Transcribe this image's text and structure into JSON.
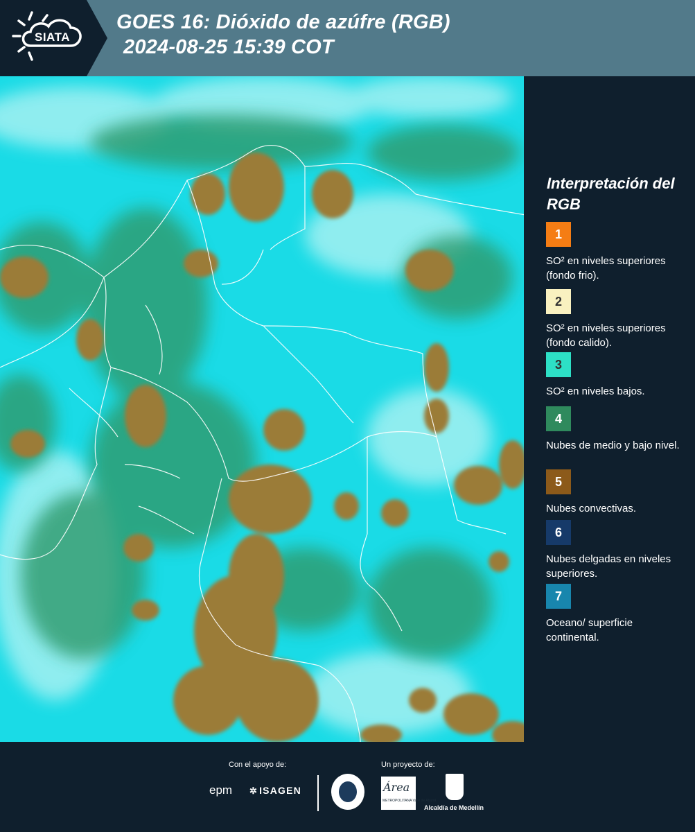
{
  "header": {
    "logo_text": "SIATA",
    "title_line1": "GOES 16: Dióxido de azúfre (RGB)",
    "title_line2": "2024-08-25 15:39 COT",
    "background_color": "#527a8a",
    "logo_bg_color": "#0f1f2d"
  },
  "map": {
    "description_icon": "satellite-rgb-map",
    "ocean_color": "#19dbe8",
    "cloud_color": "#9a7a3a",
    "low_cloud_color": "#2e9a6e",
    "border_color": "#ffffff"
  },
  "legend": {
    "title": "Interpretación del RGB",
    "items": [
      {
        "number": "1",
        "color": "#f57d14",
        "text_color": "#ffffff",
        "text": "SO² en niveles superiores (fondo frio)."
      },
      {
        "number": "2",
        "color": "#f9f1c0",
        "text_color": "#333333",
        "text": "SO² en niveles superiores (fondo calido)."
      },
      {
        "number": "3",
        "color": "#2de0c6",
        "text_color": "#333333",
        "text": "SO² en niveles bajos."
      },
      {
        "number": "4",
        "color": "#2f8a5d",
        "text_color": "#ffffff",
        "text": "Nubes de medio y bajo nivel."
      },
      {
        "number": "5",
        "color": "#8c5a1a",
        "text_color": "#ffffff",
        "text": "Nubes convectivas."
      },
      {
        "number": "6",
        "color": "#163a69",
        "text_color": "#ffffff",
        "text": "Nubes delgadas en niveles superiores."
      },
      {
        "number": "7",
        "color": "#1886ad",
        "text_color": "#ffffff",
        "text": "Oceano/ superficie continental."
      }
    ]
  },
  "footer": {
    "support_label": "Con el apoyo de:",
    "project_label": "Un proyecto de:",
    "epm_logo_text": "epm",
    "isagen_logo_text": "ISAGEN",
    "area_logo_text": "Área",
    "area_sub_text": "METROPOLITANA Valle de Aburrá",
    "medellin_logo_text": "Alcaldía de Medellín"
  }
}
